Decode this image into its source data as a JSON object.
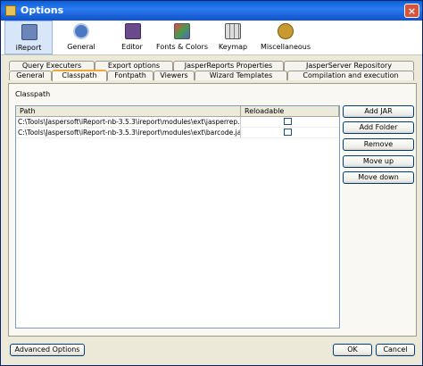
{
  "window": {
    "title": "Options",
    "close_glyph": "×"
  },
  "toolbar": {
    "items": [
      {
        "label": "iReport",
        "icon": "ireport-icon",
        "color": "#6b86b8",
        "selected": true
      },
      {
        "label": "General",
        "icon": "general-icon",
        "color": "#4a78c2"
      },
      {
        "label": "Editor",
        "icon": "editor-icon",
        "color": "#6a4a8a"
      },
      {
        "label": "Fonts & Colors",
        "icon": "fonts-colors-icon",
        "color": "#4a9a4a"
      },
      {
        "label": "Keymap",
        "icon": "keymap-icon",
        "color": "#7a7a7a"
      },
      {
        "label": "Miscellaneous",
        "icon": "miscellaneous-icon",
        "color": "#c89a30"
      }
    ]
  },
  "tabs": {
    "row1": [
      "Query Executers",
      "Export options",
      "JasperReports Properties",
      "JasperServer Repository"
    ],
    "row2": [
      "General",
      "Classpath",
      "Fontpath",
      "Viewers",
      "Wizard Templates",
      "Compilation and execution"
    ],
    "active": "Classpath"
  },
  "classpath": {
    "section_label": "Classpath",
    "columns": [
      "Path",
      "Reloadable"
    ],
    "rows": [
      {
        "path": "C:\\Tools\\Jaspersoft\\iReport-nb-3.5.3\\ireport\\modules\\ext\\jasperrep...",
        "reloadable": false
      },
      {
        "path": "C:\\Tools\\Jaspersoft\\iReport-nb-3.5.3\\ireport\\modules\\ext\\barcode.jar",
        "reloadable": false
      }
    ]
  },
  "buttons": {
    "add_jar": "Add JAR",
    "add_folder": "Add Folder",
    "remove": "Remove",
    "move_up": "Move up",
    "move_down": "Move down",
    "advanced": "Advanced Options",
    "ok": "OK",
    "cancel": "Cancel"
  },
  "colors": {
    "title_bar": "#0a5fd8",
    "active_tab_accent": "#f3a73a",
    "selected_toolbar_bg": "#d8e6f9"
  }
}
